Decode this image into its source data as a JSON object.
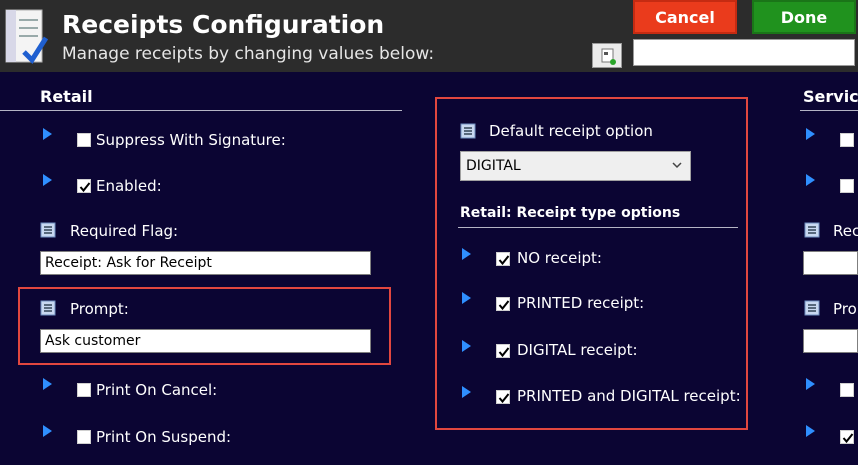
{
  "header": {
    "title": "Receipts Configuration",
    "subtitle": "Manage receipts by changing values below:",
    "cancel_label": "Cancel",
    "done_label": "Done",
    "search_value": ""
  },
  "retail": {
    "section_title": "Retail",
    "suppress_with_signature": {
      "label": "Suppress With Signature:",
      "checked": false
    },
    "enabled": {
      "label": "Enabled:",
      "checked": true
    },
    "required_flag": {
      "label": "Required Flag:",
      "value": "Receipt: Ask for Receipt"
    },
    "prompt": {
      "label": "Prompt:",
      "value": "Ask customer"
    },
    "print_on_cancel": {
      "label": "Print On Cancel:",
      "checked": false
    },
    "print_on_suspend": {
      "label": "Print On Suspend:",
      "checked": false
    }
  },
  "receipt_options": {
    "default_label": "Default receipt option",
    "default_value": "DIGITAL",
    "type_options_title": "Retail: Receipt type options",
    "options": [
      {
        "label": "NO receipt:",
        "checked": true
      },
      {
        "label": "PRINTED receipt:",
        "checked": true
      },
      {
        "label": "DIGITAL receipt:",
        "checked": true
      },
      {
        "label": "PRINTED and DIGITAL receipt:",
        "checked": true
      }
    ]
  },
  "service": {
    "section_title": "Servic",
    "required_label": "Rec",
    "prompt_label": "Pro"
  },
  "colors": {
    "background": "#0b0533",
    "header": "#2c2c2c",
    "cancel": "#ea3b1c",
    "done": "#20921e",
    "arrow": "#2f8fff",
    "highlight": "#e2473f"
  }
}
